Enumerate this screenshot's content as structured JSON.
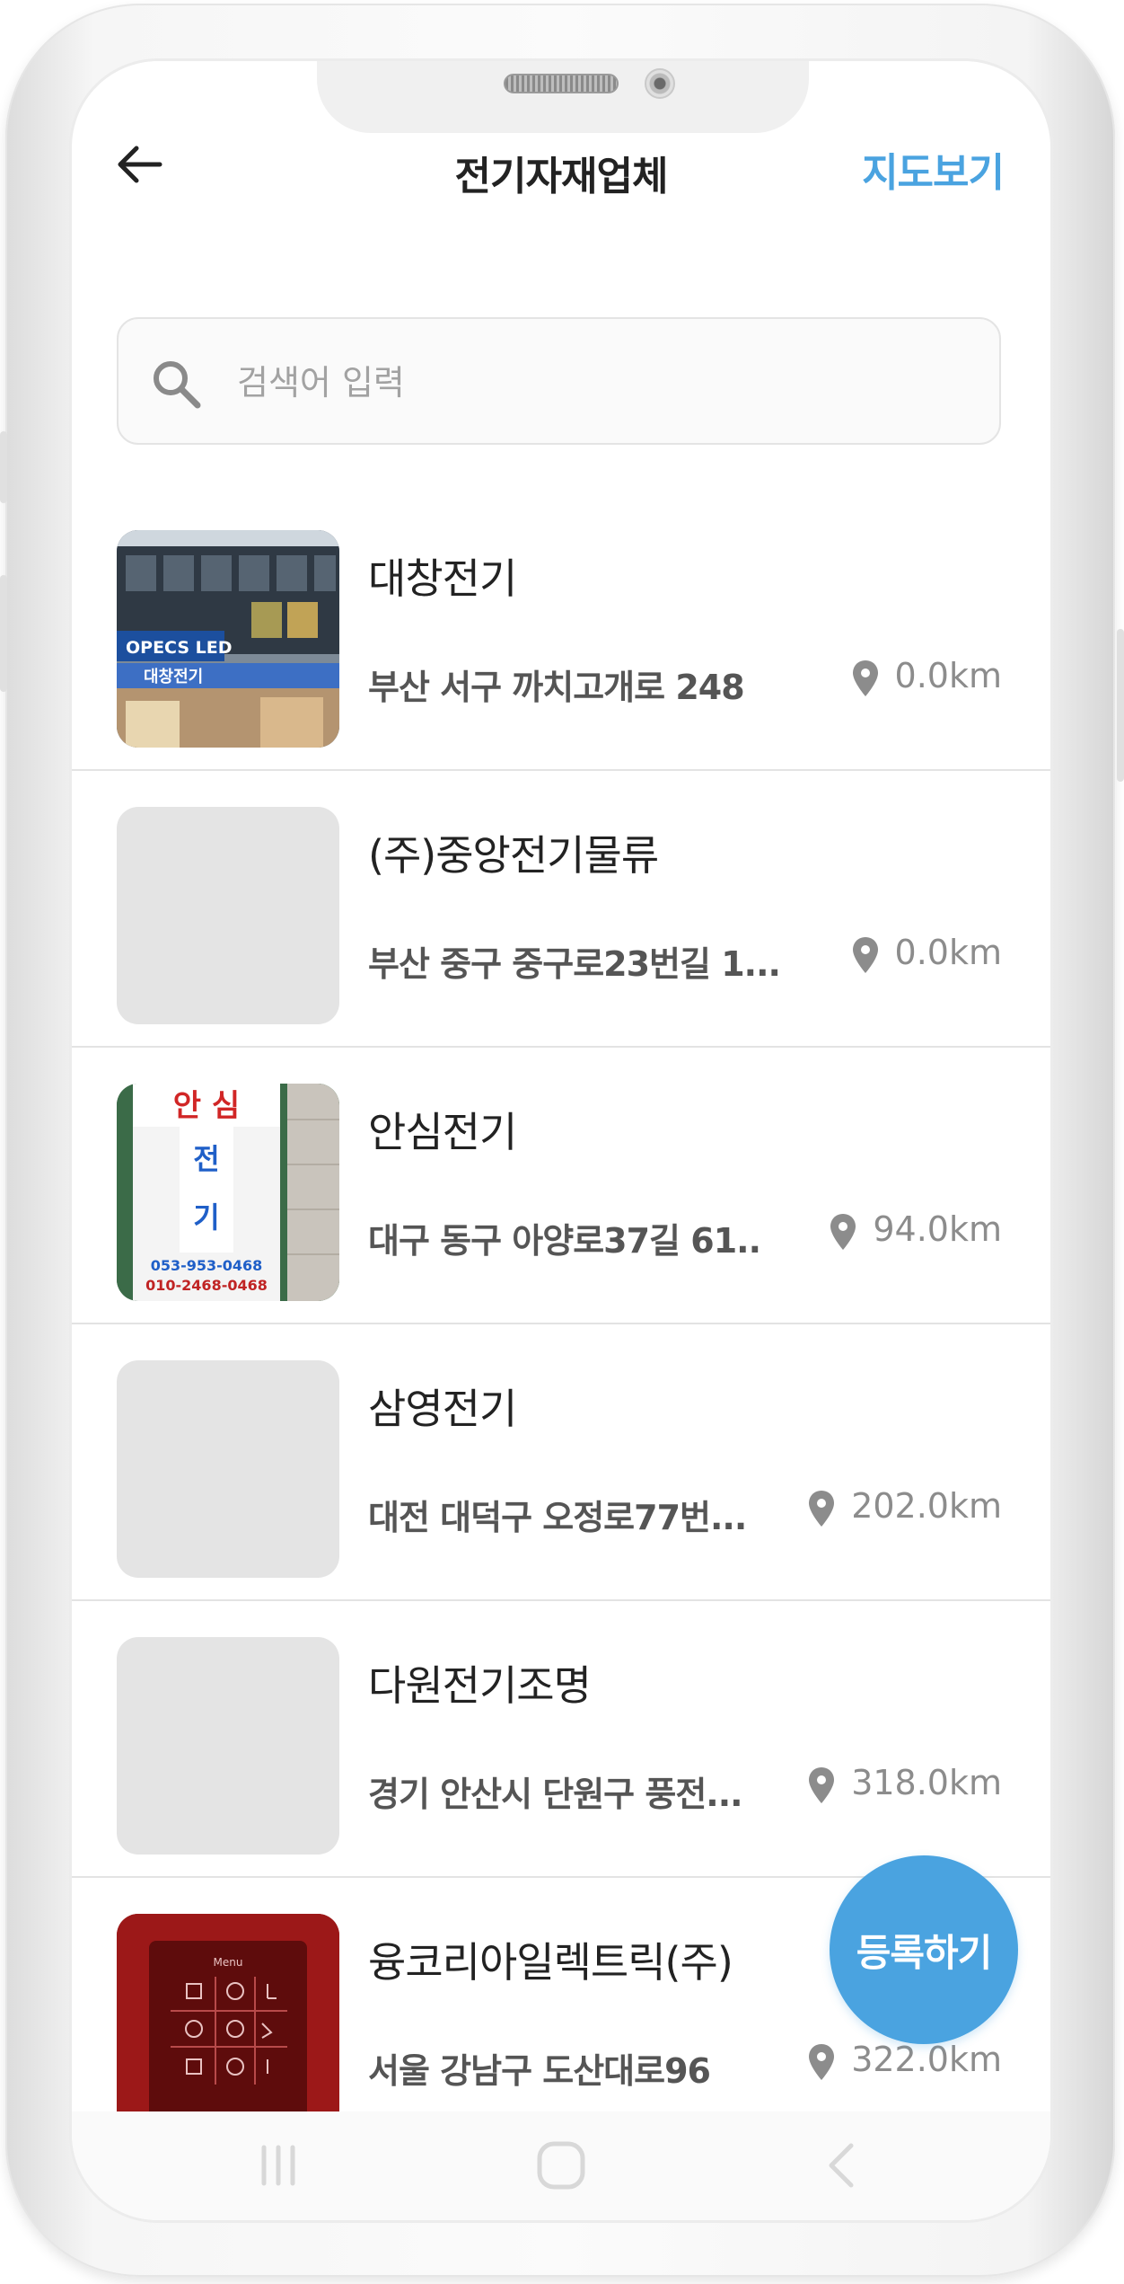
{
  "header": {
    "title": "전기자재업체",
    "map_link": "지도보기"
  },
  "search": {
    "placeholder": "검색어 입력",
    "value": ""
  },
  "list": [
    {
      "name": "대창전기",
      "address": "부산 서구 까치고개로 248",
      "distance": "0.0km",
      "has_photo": true
    },
    {
      "name": "(주)중앙전기물류",
      "address": "부산 중구 중구로23번길 1...",
      "distance": "0.0km",
      "has_photo": false
    },
    {
      "name": "안심전기",
      "address": "대구 동구 아양로37길 61...",
      "distance": "94.0km",
      "has_photo": true
    },
    {
      "name": "삼영전기",
      "address": "대전 대덕구 오정로77번...",
      "distance": "202.0km",
      "has_photo": false
    },
    {
      "name": "다원전기조명",
      "address": "경기 안산시 단원구 풍전...",
      "distance": "318.0km",
      "has_photo": false
    },
    {
      "name": "융코리아일렉트릭(주)",
      "address": "서울 강남구 도산대로96",
      "distance": "322.0km",
      "has_photo": true
    }
  ],
  "photos": {
    "sign_text_top": "안 심",
    "sign_text_middle": "전",
    "sign_text_bottom": "기",
    "sign_phone1": "053-953-0468",
    "sign_phone2": "010-2468-0468",
    "building_sign": "OPECS LED",
    "building_store_sign": "대창전기",
    "panel_label": "Menu"
  },
  "fab": {
    "label": "등록하기"
  },
  "colors": {
    "accent": "#4aa3e0",
    "placeholder_bg": "#e4e4e4"
  },
  "icons": {
    "back": "arrow-left-icon",
    "search": "magnifier-icon",
    "pin": "map-pin-icon",
    "nav": [
      "recent-apps-icon",
      "home-icon",
      "back-chevron-icon"
    ]
  }
}
